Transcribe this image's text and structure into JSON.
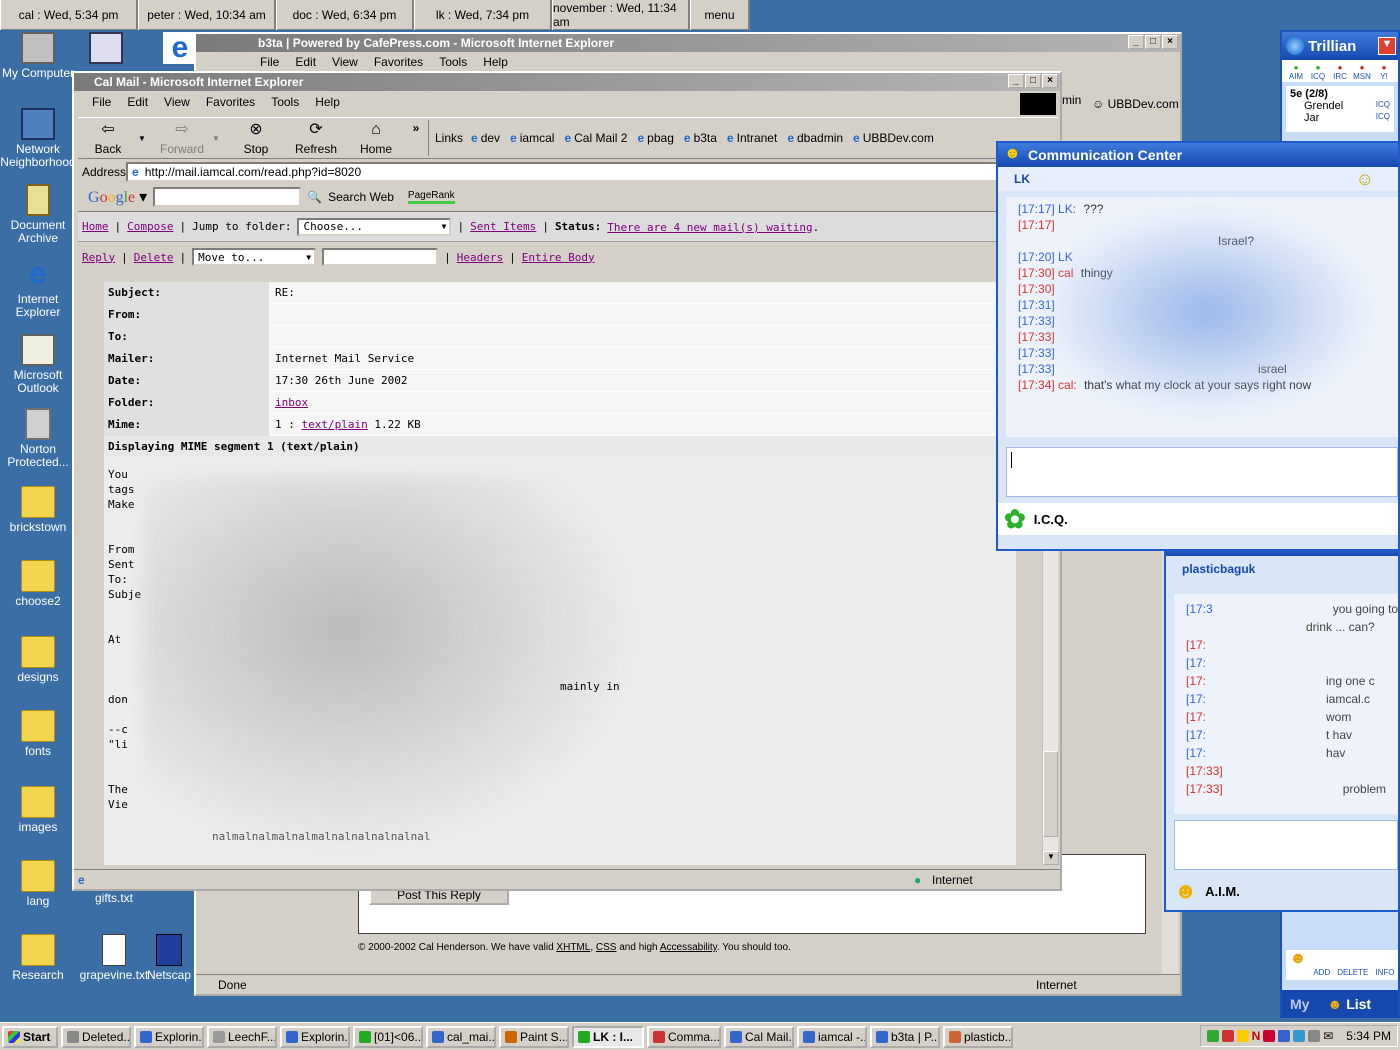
{
  "clocks": [
    {
      "label": "cal : Wed, 5:34 pm",
      "w": 138
    },
    {
      "label": "peter : Wed, 10:34 am",
      "w": 138
    },
    {
      "label": "doc : Wed, 6:34 pm",
      "w": 138
    },
    {
      "label": "lk : Wed, 7:34 pm",
      "w": 138
    },
    {
      "label": "november : Wed, 11:34 am",
      "w": 138
    },
    {
      "label": "menu",
      "w": 60
    }
  ],
  "desktop": {
    "my_computer": "My Computer",
    "network": "Network Neighborhood",
    "doc_archive": "Document Archive",
    "ie": "Internet Explorer",
    "outlook": "Microsoft Outlook",
    "norton": "Norton Protected...",
    "brickstown": "brickstown",
    "choose2": "choose2",
    "designs": "designs",
    "fonts": "fonts",
    "images": "images",
    "lang": "lang",
    "research": "Research",
    "gifts": "gifts.txt",
    "grapevine": "grapevine.txt",
    "netscape": "Netscap"
  },
  "b3ta": {
    "title": "b3ta | Powered by CafePress.com - Microsoft Internet Explorer",
    "menu": [
      "File",
      "Edit",
      "View",
      "Favorites",
      "Tools",
      "Help"
    ],
    "ubb": "UBBDev.com",
    "min_label": "min",
    "post_reply": "Post This Reply",
    "footer": "© 2000-2002 Cal Henderson. We have valid",
    "footer_xhtml": "XHTML",
    "footer_css": "CSS",
    "footer_and": "and high",
    "footer_access": "Accessability",
    "footer_end": ". You should too.",
    "status": "Done",
    "zone": "Internet"
  },
  "calmail": {
    "title": "Cal Mail - Microsoft Internet Explorer",
    "menu": [
      "File",
      "Edit",
      "View",
      "Favorites",
      "Tools",
      "Help"
    ],
    "toolbar": {
      "back": "Back",
      "forward": "Forward",
      "stop": "Stop",
      "refresh": "Refresh",
      "home": "Home",
      "more": "»"
    },
    "links_label": "Links",
    "links": [
      "dev",
      "iamcal",
      "Cal Mail 2",
      "pbag",
      "b3ta",
      "Intranet",
      "dbadmin",
      "UBBDev.com"
    ],
    "address_label": "Address",
    "address": "http://mail.iamcal.com/read.php?id=8020",
    "google": {
      "search_web": "Search Web",
      "pagerank": "PageRank"
    },
    "nav": {
      "home": "Home",
      "compose": "Compose",
      "jump": "Jump to folder:",
      "choose": "Choose...",
      "sent": "Sent Items",
      "status_label": "Status:",
      "status": "There are 4 new mail(s) waiting",
      "status_end": "."
    },
    "actions": {
      "reply": "Reply",
      "delete": "Delete",
      "move": "Move to...",
      "headers": "Headers",
      "entire": "Entire Body"
    },
    "headers": [
      {
        "k": "Subject:",
        "v": "RE:"
      },
      {
        "k": "From:",
        "v": ""
      },
      {
        "k": "To:",
        "v": ""
      },
      {
        "k": "Mailer:",
        "v": "Internet Mail Service"
      },
      {
        "k": "Date:",
        "v": "17:30 26th June 2002"
      },
      {
        "k": "Folder:",
        "v": "inbox"
      },
      {
        "k": "Mime:",
        "v": "1 :"
      }
    ],
    "mime_link": "text/plain",
    "mime_size": "1.22 KB",
    "mime_segment": "Displaying MIME segment 1 (text/plain)",
    "body_lines": [
      "You",
      "tags",
      "Make",
      "",
      "",
      "From",
      "Sent",
      "To:",
      "Subje",
      "",
      "",
      "At",
      "",
      "",
      "",
      "don",
      "",
      "--c",
      "\"li",
      "",
      "",
      "The",
      "Vie"
    ],
    "body_frag_1": "mainly in",
    "body_frag_2": "nalmalnalmalnalmalnalnalnalnalnal",
    "zone": "Internet"
  },
  "comm1": {
    "title": "Communication Center",
    "contact": "LK",
    "messages": [
      {
        "t": "[17:17]",
        "who": "LK:",
        "text": "???",
        "c": "b"
      },
      {
        "t": "[17:17]",
        "who": "",
        "text": "",
        "c": "r"
      },
      {
        "t": "",
        "who": "",
        "text": "Israel?",
        "c": "b"
      },
      {
        "t": "[17:20]",
        "who": "LK",
        "text": "",
        "c": "b"
      },
      {
        "t": "[17:30]",
        "who": "cal",
        "text": "thingy",
        "c": "r"
      },
      {
        "t": "[17:30]",
        "who": "",
        "text": "",
        "c": "r"
      },
      {
        "t": "[17:31]",
        "who": "",
        "text": "",
        "c": "b"
      },
      {
        "t": "[17:33]",
        "who": "",
        "text": "",
        "c": "b"
      },
      {
        "t": "[17:33]",
        "who": "",
        "text": "",
        "c": "r"
      },
      {
        "t": "[17:33]",
        "who": "",
        "text": "",
        "c": "b"
      },
      {
        "t": "[17:33]",
        "who": "",
        "text": "israel",
        "c": "b"
      },
      {
        "t": "[17:34]",
        "who": "cal:",
        "text": "that's what my clock at your says right now",
        "c": "r"
      }
    ],
    "footer": "I.C.Q."
  },
  "comm2": {
    "contact": "plasticbaguk",
    "messages": [
      {
        "t": "[17:3",
        "text": "you going to",
        "c": "b"
      },
      {
        "t": "",
        "text": "drink ... can?",
        "c": "b"
      },
      {
        "t": "[17:",
        "text": "",
        "c": "r"
      },
      {
        "t": "[17:",
        "text": "",
        "c": "b"
      },
      {
        "t": "[17:",
        "text": "ing one c",
        "c": "r"
      },
      {
        "t": "[17:",
        "text": "iamcal.c",
        "c": "b"
      },
      {
        "t": "[17:",
        "text": "wom",
        "c": "r"
      },
      {
        "t": "[17:",
        "text": "t hav",
        "c": "b"
      },
      {
        "t": "[17:",
        "text": "hav",
        "c": "b"
      },
      {
        "t": "[17:33]",
        "text": "",
        "c": "r"
      },
      {
        "t": "[17:33]",
        "text": "problem",
        "c": "r"
      }
    ],
    "footer": "A.I.M."
  },
  "trillian": {
    "title": "Trillian",
    "nets": [
      "AIM",
      "ICQ",
      "IRC",
      "MSN",
      "Y!"
    ],
    "group": "5e (2/8)",
    "contacts": [
      {
        "name": "Grendel",
        "net": "ICQ"
      },
      {
        "name": "Jar",
        "net": "ICQ"
      }
    ],
    "buttons": [
      "ADD",
      "DELETE",
      "INFO"
    ],
    "tab_my": "My",
    "tab_list": "List"
  },
  "taskbar": {
    "start": "Start",
    "tasks": [
      "Deleted...",
      "Explorin...",
      "LeechF...",
      "Explorin...",
      "[01]<06...",
      "cal_mai...",
      "Paint S...",
      "LK : I...",
      "Comma...",
      "Cal Mail...",
      "iamcal -...",
      "b3ta | P...",
      "plasticb..."
    ],
    "active": 7,
    "time": "5:34 PM"
  }
}
